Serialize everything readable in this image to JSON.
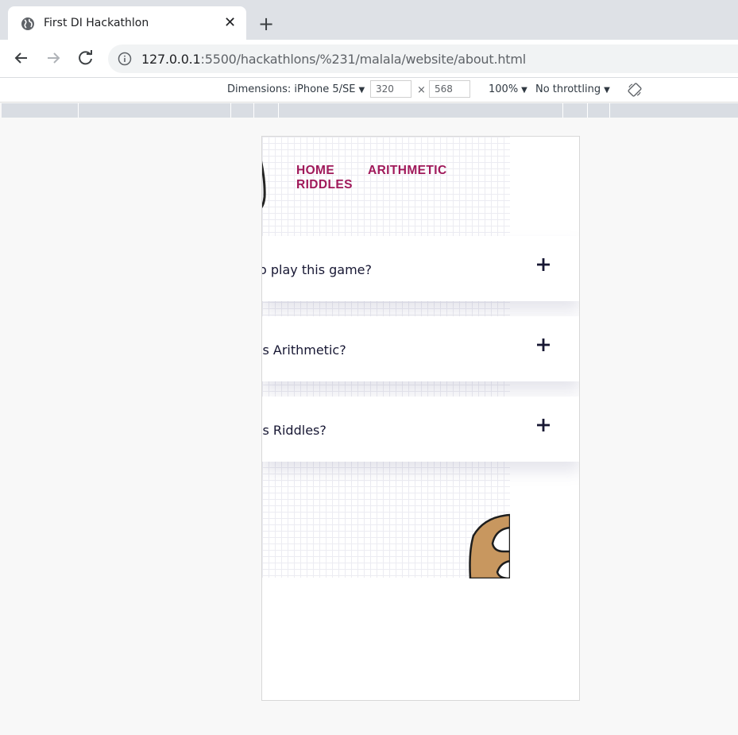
{
  "browser": {
    "tab_title": "First DI Hackathlon",
    "close_glyph": "✕",
    "newtab_glyph": "+",
    "url_host": "127.0.0.1",
    "url_rest": ":5500/hackathlons/%231/malala/website/about.html"
  },
  "devtools": {
    "dimensions_label": "Dimensions: iPhone 5/SE",
    "width": "320",
    "times": "×",
    "height": "568",
    "zoom": "100%",
    "throttling": "No throttling",
    "caret": "▼"
  },
  "page": {
    "nav": {
      "home": "HOME",
      "arithmetic": "ARITHMETIC",
      "riddles": "RIDDLES",
      "link_color": "#a0195a"
    },
    "faq": [
      {
        "question": "o play this game?"
      },
      {
        "question": "is Arithmetic?"
      },
      {
        "question": "is Riddles?"
      }
    ]
  },
  "icons": [
    "globe-icon",
    "close-icon",
    "new-tab-icon",
    "back-icon",
    "forward-icon",
    "reload-icon",
    "info-icon",
    "rotate-icon",
    "plus-icon"
  ]
}
